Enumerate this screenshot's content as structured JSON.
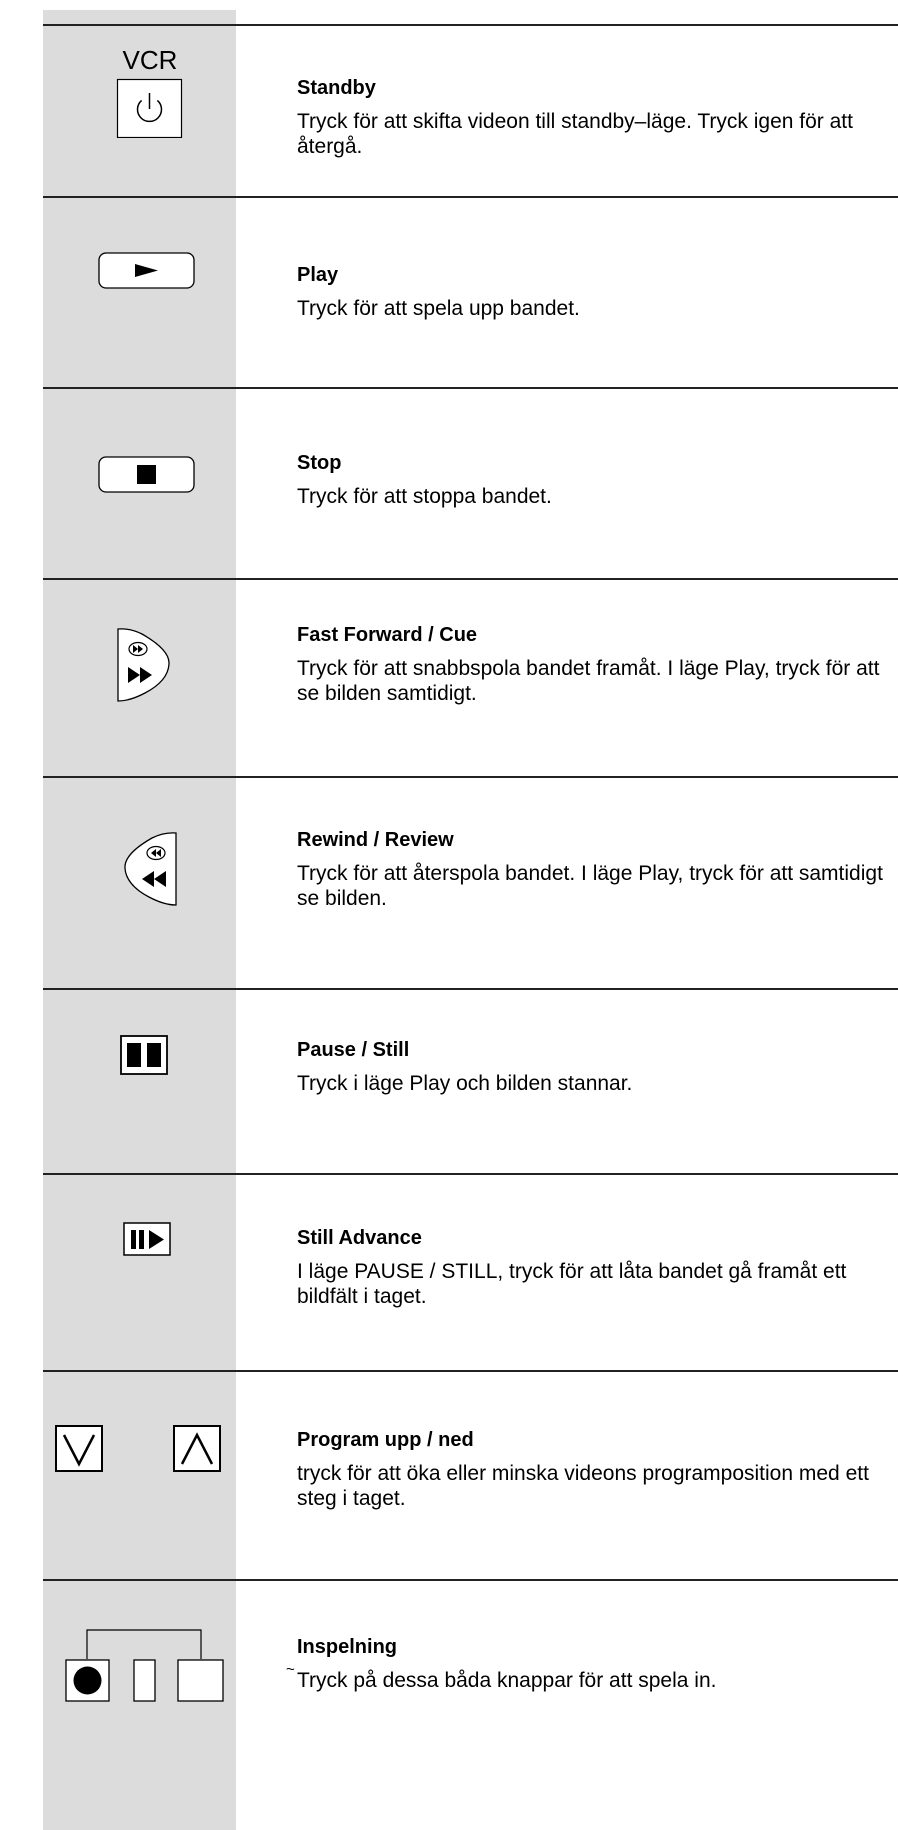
{
  "items": [
    {
      "title": "Standby",
      "desc": "Tryck för att skifta videon till standby–läge.  Tryck igen för att återgå.",
      "icon": "standby-icon",
      "icon_label": "VCR"
    },
    {
      "title": "Play",
      "desc": "Tryck för att spela upp bandet.",
      "icon": "play-icon"
    },
    {
      "title": "Stop",
      "desc": "Tryck för att stoppa bandet.",
      "icon": "stop-icon"
    },
    {
      "title": "Fast Forward / Cue",
      "desc": "Tryck för att snabbspola bandet framåt.  I läge Play, tryck för att se bilden samtidigt.",
      "icon": "fast-forward-icon"
    },
    {
      "title": "Rewind / Review",
      "desc": "Tryck för att återspola bandet.  I läge Play, tryck för att samtidigt se bilden.",
      "icon": "rewind-icon"
    },
    {
      "title": "Pause / Still",
      "desc": "Tryck i läge Play och bilden stannar.",
      "icon": "pause-icon"
    },
    {
      "title": "Still Advance",
      "desc": "I läge PAUSE / STILL, tryck för att låta bandet gå framåt ett bildfält i taget.",
      "icon": "still-advance-icon"
    },
    {
      "title": "Program upp / ned",
      "desc": "tryck för att öka eller minska videons programposition med ett steg i taget.",
      "icon": "program-up-down-icon"
    },
    {
      "title": "Inspelning",
      "desc": "Tryck på dessa båda knappar för att spela in.",
      "icon": "record-icon"
    }
  ]
}
